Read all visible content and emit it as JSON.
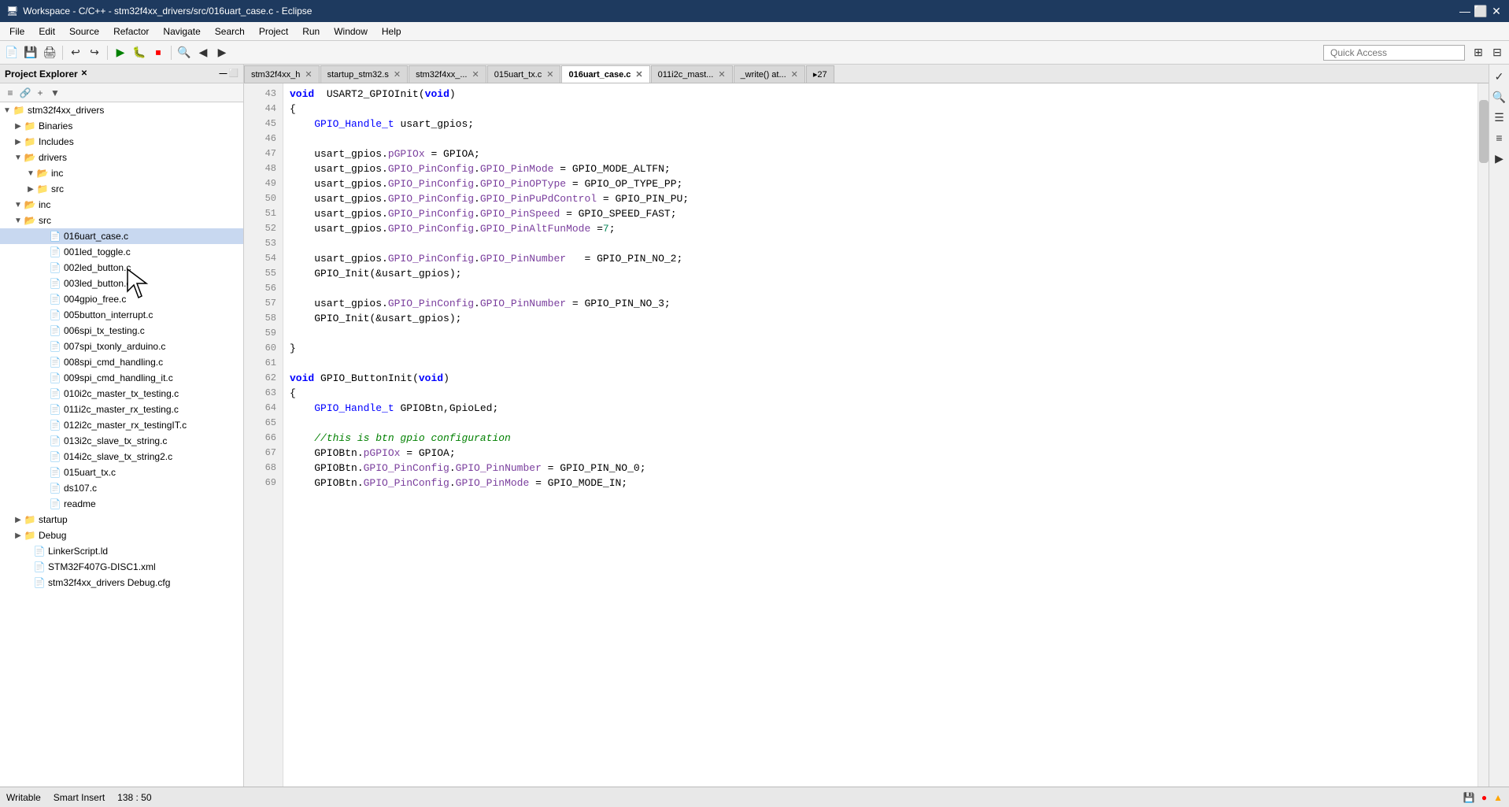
{
  "titlebar": {
    "title": "Workspace - C/C++ - stm32f4xx_drivers/src/016uart_case.c - Eclipse",
    "icon": "🖥",
    "controls": [
      "—",
      "⬜",
      "✕"
    ]
  },
  "menubar": {
    "items": [
      "File",
      "Edit",
      "Source",
      "Refactor",
      "Navigate",
      "Search",
      "Project",
      "Run",
      "Window",
      "Help"
    ]
  },
  "toolbar": {
    "quick_access_placeholder": "Quick Access"
  },
  "sidebar": {
    "title": "Project Explorer",
    "tree": [
      {
        "label": "stm32f4xx_drivers",
        "type": "project",
        "level": 0,
        "expanded": true
      },
      {
        "label": "Binaries",
        "type": "folder",
        "level": 1,
        "expanded": false
      },
      {
        "label": "Includes",
        "type": "folder",
        "level": 1,
        "expanded": false
      },
      {
        "label": "drivers",
        "type": "folder",
        "level": 1,
        "expanded": true
      },
      {
        "label": "inc",
        "type": "folder",
        "level": 2,
        "expanded": true
      },
      {
        "label": "src",
        "type": "folder",
        "level": 2,
        "expanded": false
      },
      {
        "label": "inc",
        "type": "folder",
        "level": 1,
        "expanded": false
      },
      {
        "label": "src",
        "type": "folder",
        "level": 1,
        "expanded": true
      },
      {
        "label": "016uart_case.c",
        "type": "file",
        "level": 2,
        "selected": true
      },
      {
        "label": "001led_toggle.c",
        "type": "file",
        "level": 2
      },
      {
        "label": "002led_button.c",
        "type": "file",
        "level": 2
      },
      {
        "label": "003led_button.c",
        "type": "file",
        "level": 2
      },
      {
        "label": "004gpio_free.c",
        "type": "file",
        "level": 2
      },
      {
        "label": "005button_interrupt.c",
        "type": "file",
        "level": 2
      },
      {
        "label": "006spi_tx_testing.c",
        "type": "file",
        "level": 2
      },
      {
        "label": "007spi_txonly_arduino.c",
        "type": "file",
        "level": 2
      },
      {
        "label": "008spi_cmd_handling.c",
        "type": "file",
        "level": 2
      },
      {
        "label": "009spi_cmd_handling_it.c",
        "type": "file",
        "level": 2
      },
      {
        "label": "010i2c_master_tx_testing.c",
        "type": "file",
        "level": 2
      },
      {
        "label": "011i2c_master_rx_testing.c",
        "type": "file",
        "level": 2
      },
      {
        "label": "012i2c_master_rx_testingIT.c",
        "type": "file",
        "level": 2
      },
      {
        "label": "013i2c_slave_tx_string.c",
        "type": "file",
        "level": 2
      },
      {
        "label": "014i2c_slave_tx_string2.c",
        "type": "file",
        "level": 2
      },
      {
        "label": "015uart_tx.c",
        "type": "file",
        "level": 2
      },
      {
        "label": "ds107.c",
        "type": "file",
        "level": 2
      },
      {
        "label": "readme",
        "type": "file",
        "level": 2
      },
      {
        "label": "startup",
        "type": "folder",
        "level": 1,
        "expanded": false
      },
      {
        "label": "Debug",
        "type": "folder",
        "level": 1,
        "expanded": false
      },
      {
        "label": "LinkerScript.ld",
        "type": "file",
        "level": 1
      },
      {
        "label": "STM32F407G-DISC1.xml",
        "type": "file",
        "level": 1
      },
      {
        "label": "stm32f4xx_drivers Debug.cfg",
        "type": "file",
        "level": 1
      }
    ]
  },
  "tabs": [
    {
      "label": "stm32f4xx_h",
      "closable": true,
      "active": false
    },
    {
      "label": "startup_stm32.s",
      "closable": true,
      "active": false
    },
    {
      "label": "stm32f4xx_...",
      "closable": true,
      "active": false
    },
    {
      "label": "015uart_tx.c",
      "closable": true,
      "active": false
    },
    {
      "label": "016uart_case.c",
      "closable": true,
      "active": true
    },
    {
      "label": "011i2c_mast...",
      "closable": true,
      "active": false
    },
    {
      "label": "_write() at...",
      "closable": true,
      "active": false
    },
    {
      "label": "▸27",
      "closable": false,
      "active": false
    }
  ],
  "code": {
    "filename": "016uart_case.c",
    "lines": [
      {
        "num": 43,
        "text": "void  USART2_GPIOInit(void)"
      },
      {
        "num": 44,
        "text": "{"
      },
      {
        "num": 45,
        "text": "\tGPIO_Handle_t usart_gpios;"
      },
      {
        "num": 46,
        "text": ""
      },
      {
        "num": 47,
        "text": "\tusart_gpios.pGPIOx = GPIOA;"
      },
      {
        "num": 48,
        "text": "\tusart_gpios.GPIO_PinConfig.GPIO_PinMode = GPIO_MODE_ALTFN;"
      },
      {
        "num": 49,
        "text": "\tusart_gpios.GPIO_PinConfig.GPIO_PinOPType = GPIO_OP_TYPE_PP;"
      },
      {
        "num": 50,
        "text": "\tusart_gpios.GPIO_PinConfig.GPIO_PinPuPdControl = GPIO_PIN_PU;"
      },
      {
        "num": 51,
        "text": "\tusart_gpios.GPIO_PinConfig.GPIO_PinSpeed = GPIO_SPEED_FAST;"
      },
      {
        "num": 52,
        "text": "\tusart_gpios.GPIO_PinConfig.GPIO_PinAltFunMode =7;"
      },
      {
        "num": 53,
        "text": ""
      },
      {
        "num": 54,
        "text": "\tusart_gpios.GPIO_PinConfig.GPIO_PinNumber\t= GPIO_PIN_NO_2;"
      },
      {
        "num": 55,
        "text": "\tGPIO_Init(&usart_gpios);"
      },
      {
        "num": 56,
        "text": ""
      },
      {
        "num": 57,
        "text": "\tusart_gpios.GPIO_PinConfig.GPIO_PinNumber = GPIO_PIN_NO_3;"
      },
      {
        "num": 58,
        "text": "\tGPIO_Init(&usart_gpios);"
      },
      {
        "num": 59,
        "text": ""
      },
      {
        "num": 60,
        "text": "}"
      },
      {
        "num": 61,
        "text": ""
      },
      {
        "num": 62,
        "text": "void GPIO_ButtonInit(void)"
      },
      {
        "num": 63,
        "text": "{"
      },
      {
        "num": 64,
        "text": "\tGPIO_Handle_t GPIOBtn,GpioLed;"
      },
      {
        "num": 65,
        "text": ""
      },
      {
        "num": 66,
        "text": "\t//this is btn gpio configuration"
      },
      {
        "num": 67,
        "text": "\tGPIOBtn.pGPIOx = GPIOA;"
      },
      {
        "num": 68,
        "text": "\tGPIOBtn.GPIO_PinConfig.GPIO_PinNumber = GPIO_PIN_NO_0;"
      },
      {
        "num": 69,
        "text": "\tGPIOBtn.GPIO_PinConfig.GPIO_PinMode = GPIO_MODE_IN;"
      }
    ]
  },
  "statusbar": {
    "writable": "Writable",
    "insert_mode": "Smart Insert",
    "position": "138 : 50"
  }
}
